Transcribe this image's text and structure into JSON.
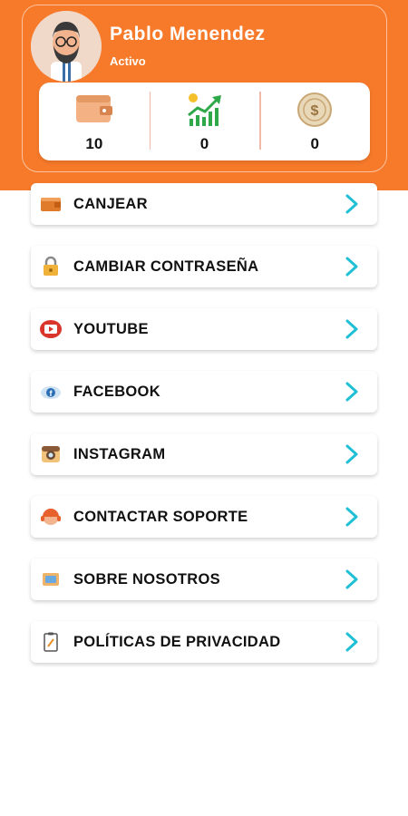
{
  "profile": {
    "name": "Pablo Menendez",
    "status": "Activo"
  },
  "stats": [
    {
      "icon": "wallet-icon",
      "value": "10"
    },
    {
      "icon": "growth-chart-icon",
      "value": "0"
    },
    {
      "icon": "dollar-coin-icon",
      "value": "0"
    }
  ],
  "menu": [
    {
      "label": "CANJEAR",
      "icon": "wallet-icon"
    },
    {
      "label": "CAMBIAR CONTRASEÑA",
      "icon": "lock-icon"
    },
    {
      "label": "YOUTUBE",
      "icon": "youtube-icon"
    },
    {
      "label": "FACEBOOK",
      "icon": "facebook-icon"
    },
    {
      "label": "INSTAGRAM",
      "icon": "instagram-icon"
    },
    {
      "label": "CONTACTAR SOPORTE",
      "icon": "support-agent-icon"
    },
    {
      "label": "SOBRE NOSOTROS",
      "icon": "info-tv-icon"
    },
    {
      "label": "POLÍTICAS DE PRIVACIDAD",
      "icon": "clipboard-icon"
    }
  ],
  "colors": {
    "header": "#f77a2a",
    "arrow": "#1fc0d6",
    "divider": "#f0b9a8"
  }
}
